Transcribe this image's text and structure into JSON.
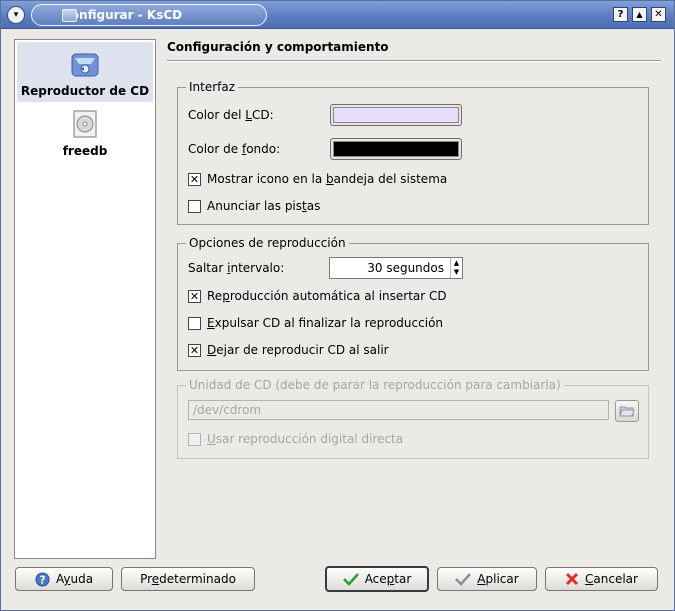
{
  "window": {
    "title": "Configurar - KsCD",
    "menu_glyph": "▾",
    "help_glyph": "?",
    "keep_above_glyph": "▲",
    "close_glyph": "✕"
  },
  "sidebar": {
    "items": [
      {
        "label": "Reproductor de CD",
        "icon": "cd-player-icon",
        "selected": true
      },
      {
        "label": "freedb",
        "icon": "freedb-icon",
        "selected": false
      }
    ]
  },
  "page": {
    "title": "Configuración y comportamiento"
  },
  "interfaz": {
    "legend": "Interfaz",
    "lcd_color_label": {
      "pre": "Color del ",
      "key": "L",
      "post": "CD:"
    },
    "lcd_color_value": "#e6dcfc",
    "bg_color_label": {
      "pre": "Color de ",
      "key": "f",
      "post": "ondo:"
    },
    "bg_color_value": "#000000",
    "tray_icon": {
      "pre": "Mostrar icono en la ",
      "key": "b",
      "post": "andeja del sistema",
      "checked": true
    },
    "announce": {
      "pre": "Anunciar las pis",
      "key": "t",
      "post": "as",
      "checked": false
    }
  },
  "playback": {
    "legend": "Opciones de reproducción",
    "skip_label": {
      "pre": "Saltar ",
      "key": "i",
      "post": "ntervalo:"
    },
    "skip_value": "30 segundos",
    "autoplay": {
      "pre": "Re",
      "key": "p",
      "post": "roducción automática al insertar CD",
      "checked": true
    },
    "eject": {
      "pre": "",
      "key": "E",
      "post": "xpulsar CD al finalizar la reproducción",
      "checked": false
    },
    "stop_on_exit": {
      "pre": "",
      "key": "D",
      "post": "ejar de reproducir CD al salir",
      "checked": true
    }
  },
  "device": {
    "legend": "Unidad de CD (debe de parar la reproducción para cambiarla)",
    "path": "/dev/cdrom",
    "digital": {
      "pre": "",
      "key": "U",
      "post": "sar reproducción digital directa",
      "checked": false
    }
  },
  "buttons": {
    "help": {
      "pre": "A",
      "key": "y",
      "post": "uda"
    },
    "defaults": {
      "pre": "Pr",
      "key": "e",
      "post": "determinado"
    },
    "ok": {
      "pre": "Ace",
      "key": "p",
      "post": "tar"
    },
    "apply": {
      "pre": "",
      "key": "A",
      "post": "plicar"
    },
    "cancel": {
      "pre": "",
      "key": "C",
      "post": "ancelar"
    }
  },
  "check_glyph": "✕"
}
